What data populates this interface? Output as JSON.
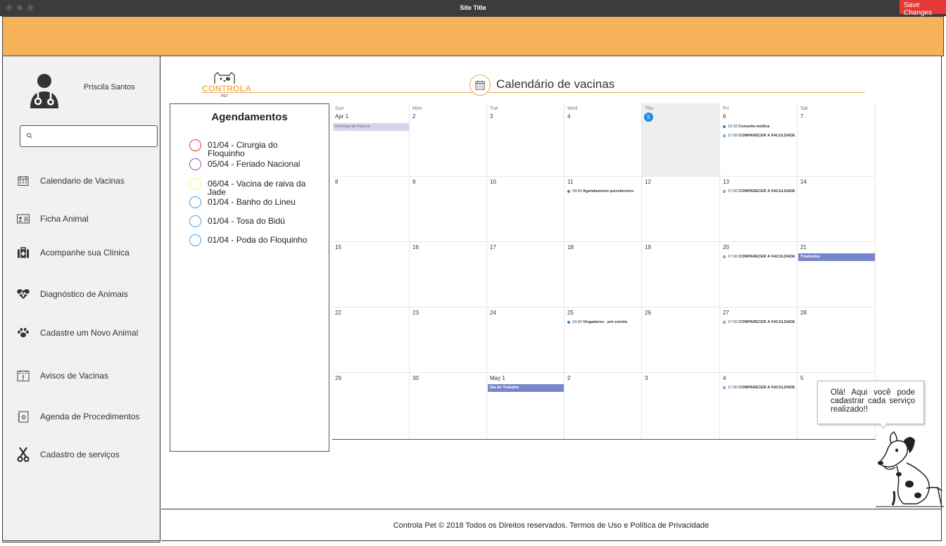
{
  "window": {
    "title": "Site Title",
    "save_button": "Save Changes"
  },
  "user": {
    "name": "Priscila Santos"
  },
  "search": {
    "placeholder": "",
    "value": ""
  },
  "nav": [
    {
      "label": "Calendario de Vacinas",
      "icon": "calendar-icon"
    },
    {
      "label": "Ficha Animal",
      "icon": "id-card-icon"
    },
    {
      "label": "Acompanhe sua Clínica",
      "icon": "medical-kit-icon"
    },
    {
      "label": "Diagnóstico de Animais",
      "icon": "heartbeat-icon"
    },
    {
      "label": "Cadastre um Novo Animal",
      "icon": "paw-icon"
    },
    {
      "label": "Avisos de Vacinas",
      "icon": "calendar-alert-icon"
    },
    {
      "label": "Agenda de Procedimentos",
      "icon": "address-book-icon"
    },
    {
      "label": "Cadastro de serviços",
      "icon": "scissors-icon"
    }
  ],
  "logo": {
    "text": "CONTROLA",
    "subtext": "PET"
  },
  "calendar_title": "Calendário de vacinas",
  "appointments": {
    "title": "Agendamentos",
    "items": [
      {
        "text": "01/04 - Cirurgia do Floquinho",
        "color": "#e53935"
      },
      {
        "text": "05/04 - Feriado Nacional",
        "color": "#ab47bc"
      },
      {
        "text": "06/04 - Vacina de raiva da Jade",
        "color": "#fff176"
      },
      {
        "text": "01/04 - Banho do Lineu",
        "color": "#42a5f5"
      },
      {
        "text": "01/04 - Tosa do Bidú",
        "color": "#42a5f5"
      },
      {
        "text": "01/04 - Poda do Floquinho",
        "color": "#42a5f5"
      }
    ]
  },
  "calendar": {
    "weekdays": [
      "Sun",
      "Mon",
      "Tue",
      "Wed",
      "Thu",
      "Fri",
      "Sat"
    ],
    "today_label": "5",
    "weeks": [
      [
        {
          "num": "Apr 1",
          "bars": [
            {
              "text": "Domingo de Páscoa",
              "style": "light"
            }
          ]
        },
        {
          "num": "2"
        },
        {
          "num": "3"
        },
        {
          "num": "4"
        },
        {
          "num": "5",
          "today": true
        },
        {
          "num": "6",
          "dots": [
            {
              "time": "13:30",
              "title": "Consulta médica",
              "filled": true
            },
            {
              "time": "17:00",
              "title": "COMPARECER À FACULDADE",
              "filled": false
            }
          ]
        },
        {
          "num": "7"
        }
      ],
      [
        {
          "num": "8"
        },
        {
          "num": "9"
        },
        {
          "num": "10"
        },
        {
          "num": "11",
          "dots": [
            {
              "time": "09:00",
              "title": "Agendamento psicotécnico",
              "filled": true
            }
          ]
        },
        {
          "num": "12"
        },
        {
          "num": "13",
          "dots": [
            {
              "time": "17:00",
              "title": "COMPARECER À FACULDADE",
              "filled": false
            }
          ]
        },
        {
          "num": "14"
        }
      ],
      [
        {
          "num": "15"
        },
        {
          "num": "16"
        },
        {
          "num": "17"
        },
        {
          "num": "18"
        },
        {
          "num": "19"
        },
        {
          "num": "20",
          "dots": [
            {
              "time": "17:00",
              "title": "COMPARECER À FACULDADE",
              "filled": false
            }
          ]
        },
        {
          "num": "21",
          "bars": [
            {
              "text": "Tiradentes",
              "style": "dark"
            }
          ]
        }
      ],
      [
        {
          "num": "22"
        },
        {
          "num": "23"
        },
        {
          "num": "24"
        },
        {
          "num": "25",
          "dots": [
            {
              "time": "23:00",
              "title": "Vingadores - pré estréia",
              "filled": true
            }
          ]
        },
        {
          "num": "26"
        },
        {
          "num": "27",
          "dots": [
            {
              "time": "17:00",
              "title": "COMPARECER À FACULDADE",
              "filled": false
            }
          ]
        },
        {
          "num": "28"
        }
      ],
      [
        {
          "num": "29"
        },
        {
          "num": "30"
        },
        {
          "num": "May 1",
          "bars": [
            {
              "text": "Dia do Trabalho",
              "style": "dark"
            }
          ]
        },
        {
          "num": "2"
        },
        {
          "num": "3"
        },
        {
          "num": "4",
          "dots": [
            {
              "time": "17:00",
              "title": "COMPARECER À FACULDADE",
              "filled": false
            }
          ]
        },
        {
          "num": "5"
        }
      ]
    ]
  },
  "speech_bubble": "Olá! Aqui você pode cadastrar cada serviço realizado!!",
  "footer": "Controla Pet © 2018 Todos os Direitos reservados. Termos de Uso e Política de Privacidade",
  "colors": {
    "banner": "#f5b259",
    "accent": "#f0a95a",
    "event_dark": "#7986cb",
    "today": "#1e88e5",
    "save": "#e53935"
  }
}
